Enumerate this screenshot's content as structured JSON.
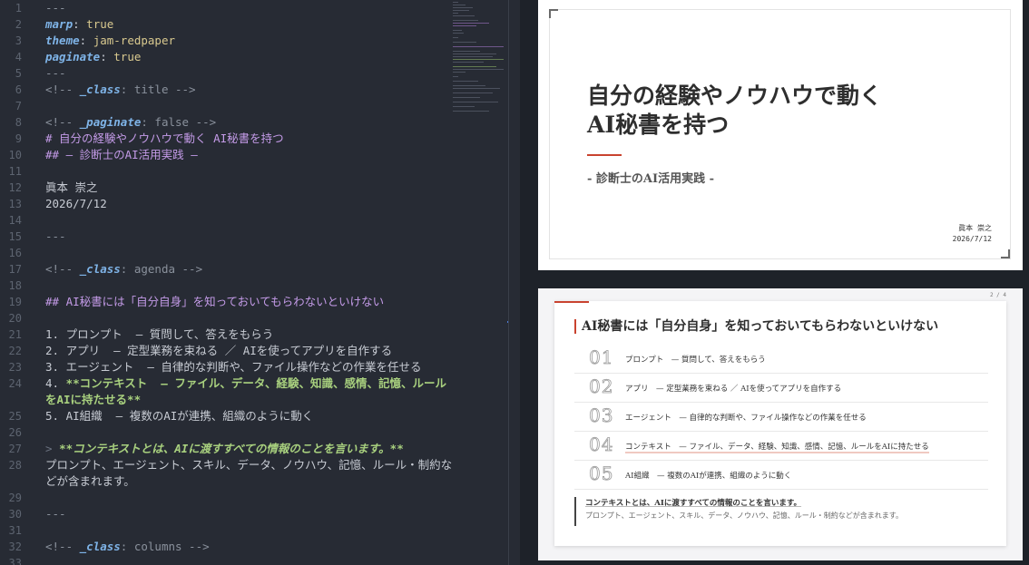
{
  "editor": {
    "line_numbers": [
      "1",
      "2",
      "3",
      "4",
      "5",
      "6",
      "7",
      "8",
      "9",
      "10",
      "11",
      "12",
      "13",
      "14",
      "15",
      "16",
      "17",
      "18",
      "19",
      "20",
      "21",
      "22",
      "23",
      "24",
      "25",
      "26",
      "27",
      "28",
      "29",
      "30",
      "31",
      "32",
      "33"
    ],
    "front_matter": {
      "sep": "---",
      "marp_key": "marp",
      "marp_val": "true",
      "theme_key": "theme",
      "theme_val": "jam-redpaper",
      "paginate_key": "paginate",
      "paginate_val": "true"
    },
    "directive_title_open": "<!-- ",
    "directive_class_key": "_class",
    "directive_title_rest": ": title -->",
    "directive_paginate_key": "_paginate",
    "directive_paginate_rest": ": false -->",
    "h1": "# 自分の経験やノウハウで動く AI秘書を持つ",
    "h2": "## – 診断士のAI活用実践 –",
    "author": "眞本 崇之",
    "date": "2026/7/12",
    "directive_agenda_rest": ": agenda -->",
    "h2_agenda": "## AI秘書には「自分自身」を知っておいてもらわないといけない",
    "list": [
      "1. プロンプト  – 質問して、答えをもらう",
      "2. アプリ  – 定型業務を束ねる ／ AIを使ってアプリを自作する",
      "3. エージェント  – 自律的な判断や、ファイル操作などの作業を任せる"
    ],
    "list4_prefix": "4. ",
    "list4_bold": "**コンテキスト  – ファイル、データ、経験、知識、感情、記憶、ルール",
    "list4_bold2": "をAIに持たせる**",
    "list5": "5. AI組織  – 複数のAIが連携、組織のように動く",
    "quote_mark": "> ",
    "quote_bold": "**コンテキストとは、AIに渡すすべての情報のことを言います。**",
    "para1": "プロンプト、エージェント、スキル、データ、ノウハウ、記憶、ルール・制約な",
    "para2": "どが含まれます。",
    "directive_columns_rest": ": columns -->"
  },
  "slide1": {
    "title_line1": "自分の経験やノウハウで動く",
    "title_line2": "AI秘書を持つ",
    "subtitle": "- 診断士のAI活用実践 -",
    "author": "眞本 崇之",
    "date": "2026/7/12"
  },
  "slide2": {
    "page": "2 / 4",
    "title": "AI秘書には「自分自身」を知っておいてもらわないといけない",
    "items": [
      {
        "num": "01",
        "text": "プロンプト　— 質問して、答えをもらう"
      },
      {
        "num": "02",
        "text": "アプリ　— 定型業務を束ねる ／ AIを使ってアプリを自作する"
      },
      {
        "num": "03",
        "text": "エージェント　— 自律的な判断や、ファイル操作などの作業を任せる"
      },
      {
        "num": "04",
        "text": "コンテキスト　— ファイル、データ、経験、知識、感情、記憶、ルールをAIに持たせる"
      },
      {
        "num": "05",
        "text": "AI組織　— 複数のAIが連携、組織のように動く"
      }
    ],
    "note_bold": "コンテキストとは、AIに渡すすべての情報のことを言います。",
    "note_text": "プロンプト、エージェント、スキル、データ、ノウハウ、記憶、ルール・制約などが含まれます。"
  }
}
